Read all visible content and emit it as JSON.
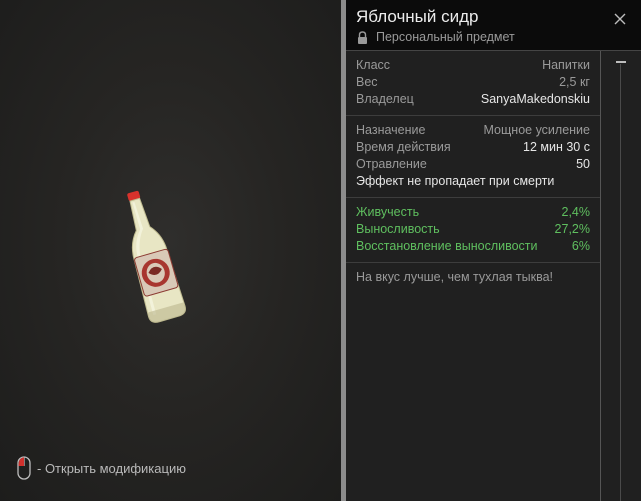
{
  "item": {
    "title": "Яблочный сидр",
    "subtitle": "Персональный предмет"
  },
  "stats": [
    {
      "label": "Класс",
      "value": "Напитки"
    },
    {
      "label": "Вес",
      "value": "2,5 кг"
    },
    {
      "label": "Владелец",
      "value": "SanyaMakedonskiu"
    }
  ],
  "effects": {
    "purpose": {
      "label": "Назначение",
      "value": "Мощное усиление"
    },
    "duration": {
      "label": "Время действия",
      "value": "12 мин 30 с"
    },
    "poison": {
      "label": "Отравление",
      "value": "50"
    },
    "note": "Эффект не пропадает при смерти"
  },
  "bonuses": [
    {
      "label": "Живучесть",
      "value": "2,4%"
    },
    {
      "label": "Выносливость",
      "value": "27,2%"
    },
    {
      "label": "Восстановление выносливости",
      "value": "6%"
    }
  ],
  "description": "На вкус лучше, чем тухлая тыква!",
  "hint": {
    "text": "- Открыть модификацию"
  },
  "colors": {
    "bonus_green": "#5fbf5f",
    "header_bg": "#0b0b0b",
    "panel_bg": "#202020"
  }
}
